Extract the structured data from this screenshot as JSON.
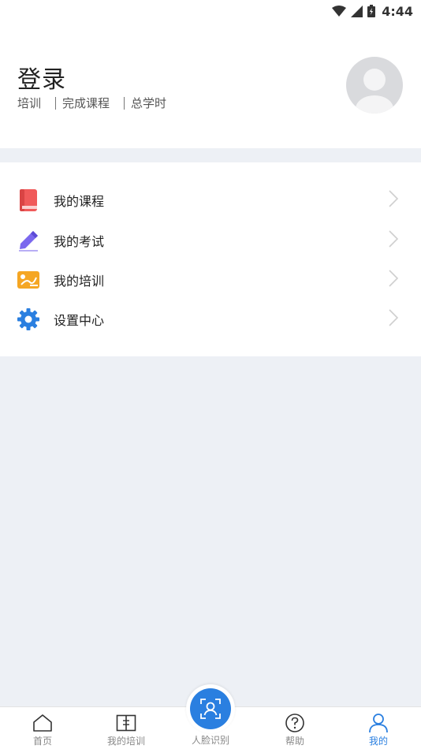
{
  "status_bar": {
    "time": "4:44"
  },
  "profile": {
    "title": "登录",
    "stats": [
      "培训",
      "完成课程",
      "总学时"
    ]
  },
  "menu": {
    "items": [
      {
        "label": "我的课程",
        "icon": "book-icon",
        "color": "#f05a5a"
      },
      {
        "label": "我的考试",
        "icon": "pencil-icon",
        "color": "#7b68ee"
      },
      {
        "label": "我的培训",
        "icon": "training-icon",
        "color": "#f5a623"
      },
      {
        "label": "设置中心",
        "icon": "gear-icon",
        "color": "#2a7fe0"
      }
    ]
  },
  "tabbar": {
    "tabs": [
      {
        "label": "首页",
        "icon": "home-icon"
      },
      {
        "label": "我的培训",
        "icon": "open-book-icon"
      },
      {
        "label": "人脸识别",
        "icon": "face-scan-icon"
      },
      {
        "label": "帮助",
        "icon": "help-icon"
      },
      {
        "label": "我的",
        "icon": "person-icon"
      }
    ],
    "active_color": "#2a7fe0"
  }
}
